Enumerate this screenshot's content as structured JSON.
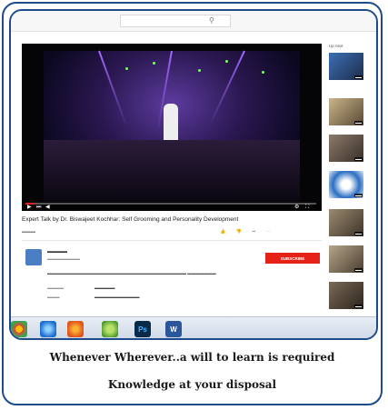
{
  "video": {
    "title": "Expert Talk by Dr. Biswajeet Kochhar: Self Grooming and Personality Development",
    "progress_fraction": 0.03
  },
  "sidebar": {
    "header": "Up next"
  },
  "channel": {
    "subscribe_label": "SUBSCRIBE"
  },
  "taskbar": {
    "icons": [
      "chrome-icon",
      "ie-icon",
      "firefox-icon",
      "media-icon",
      "photoshop-icon",
      "word-icon"
    ],
    "photoshop_label": "Ps",
    "word_label": "W"
  },
  "captions": {
    "line1": "Whenever Wherever..a will to learn is required",
    "line2": "Knowledge at your disposal"
  },
  "colors": {
    "frame_border": "#1f4a8c",
    "subscribe": "#e62117",
    "progress": "#e62117"
  }
}
